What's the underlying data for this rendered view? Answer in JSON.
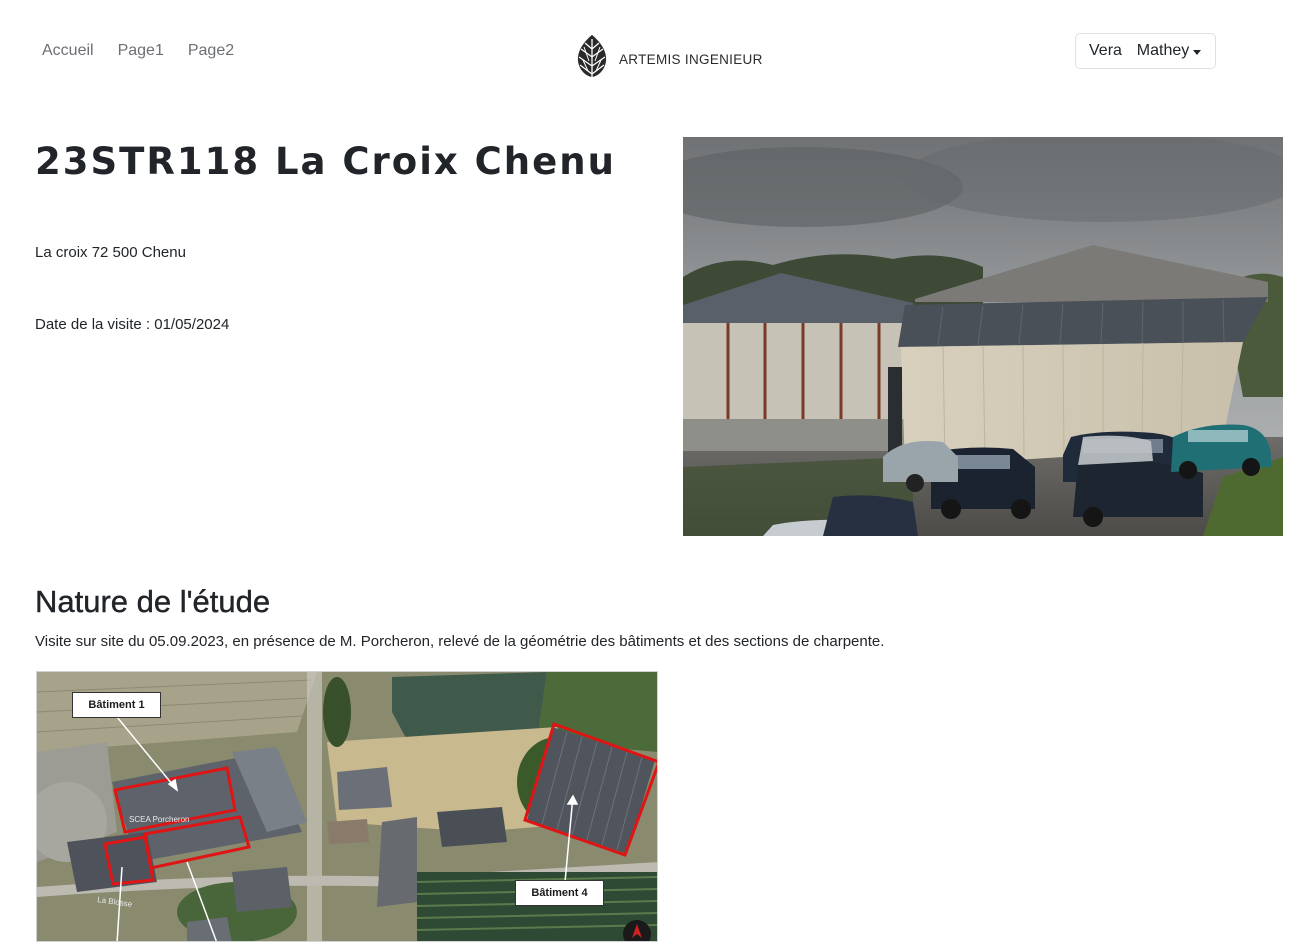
{
  "nav": {
    "links": [
      "Accueil",
      "Page1",
      "Page2"
    ],
    "brand_name": "ARTEMIS INGENIEUR",
    "brand_logo_icon": "pine-cone-logo-icon",
    "user_name": "Vera  Mathey",
    "user_menu_icon": "caret-down-icon"
  },
  "project": {
    "title": "23STR118 La Croix Chenu",
    "address": "La croix 72 500 Chenu",
    "visit_date_label": "Date de la visite : ",
    "visit_date": "01/05/2024"
  },
  "study": {
    "heading": "Nature de l'étude",
    "description": "Visite sur site du 05.09.2023, en présence de M. Porcheron, relevé de la géométrie des bâtiments et des sections de charpente.",
    "map": {
      "labels": [
        "Bâtiment 1",
        "Bâtiment 4"
      ],
      "road_label": "La Blosse",
      "farm_label": "SCEA Porcheron",
      "highlight_color": "#e01414",
      "compass_icon": "compass-icon"
    }
  },
  "colors": {
    "text": "#212529",
    "nav_link": "#6c6f73",
    "border": "#dee2e6"
  }
}
